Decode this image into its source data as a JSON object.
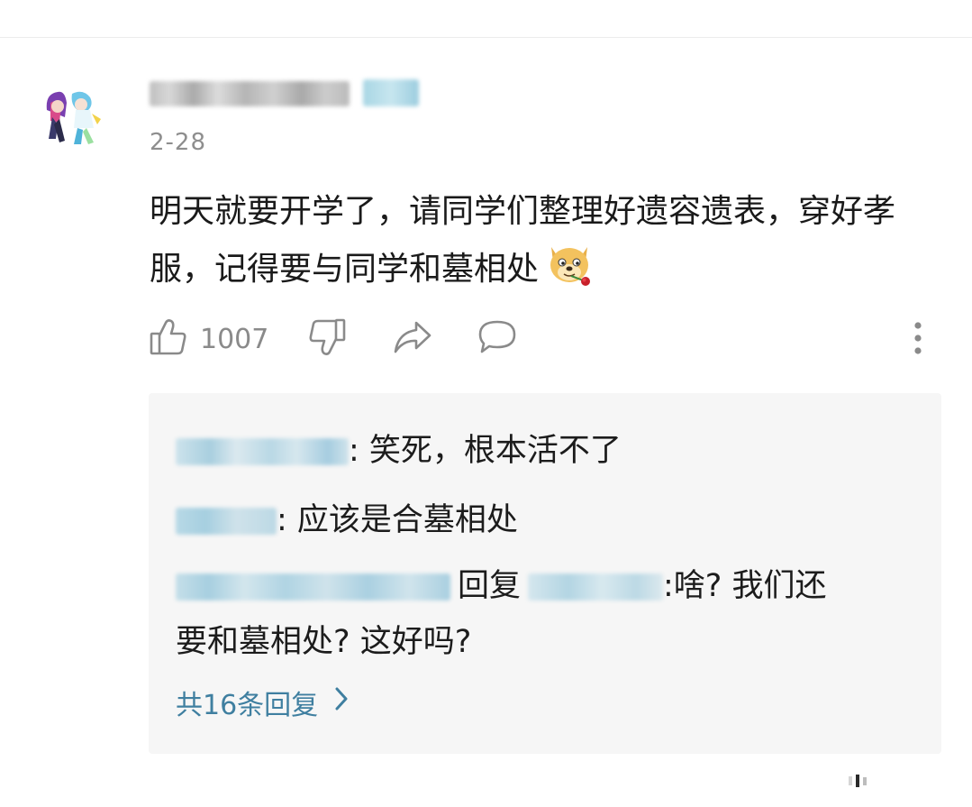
{
  "comment": {
    "date": "2-28",
    "text": "明天就要开学了，请同学们整理好遗容遗表，穿好孝服，记得要与同学和墓相处",
    "emoji": "doge-rose-emoji"
  },
  "actions": {
    "like_count": "1007",
    "icons": [
      "thumbs-up-icon",
      "thumbs-down-icon",
      "share-icon",
      "comment-bubble-icon",
      "more-vertical-icon"
    ]
  },
  "replies": {
    "items": [
      {
        "text": ": 笑死，根本活不了"
      },
      {
        "text": ": 应该是合墓相处"
      },
      {
        "reply_word": "回复",
        "text_line1": ":啥? 我们还",
        "text_line2": "要和墓相处? 这好吗?"
      }
    ],
    "more_label": "共16条回复"
  },
  "colors": {
    "date": "#8e8e8e",
    "icon": "#8a8a8a",
    "link": "#3f7fa0",
    "reply_bg": "#f6f6f6"
  }
}
